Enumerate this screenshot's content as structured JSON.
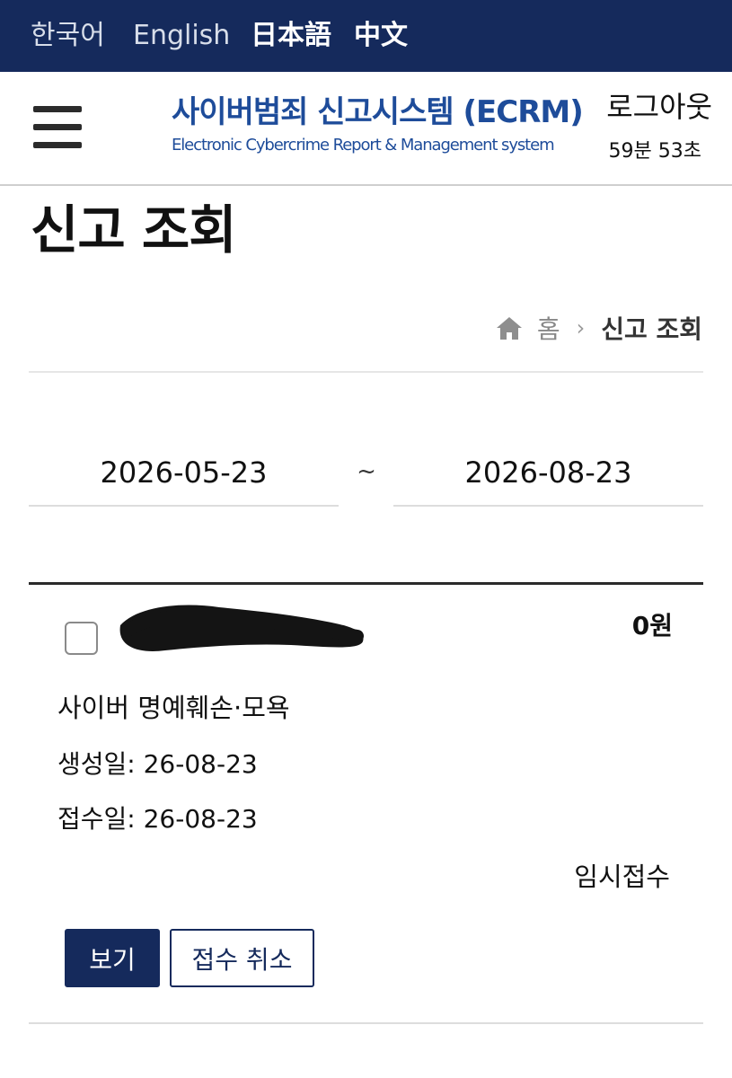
{
  "languages": [
    {
      "label": "한국어",
      "selected": false
    },
    {
      "label": "English",
      "selected": false
    },
    {
      "label": "日本語",
      "selected": true
    },
    {
      "label": "中文",
      "selected": true
    }
  ],
  "header": {
    "title": "사이버범죄 신고시스템 (ECRM)",
    "subtitle": "Electronic Cybercrime Report & Management system",
    "logout_label": "로그아웃",
    "session_timer": "59분 53초",
    "menu_icon": "hamburger-menu-icon"
  },
  "page": {
    "title": "신고 조회"
  },
  "breadcrumb": {
    "home_icon": "home-icon",
    "home_label": "홈",
    "separator": "›",
    "current": "신고 조회"
  },
  "date_range": {
    "from": "2026-05-23",
    "separator": "~",
    "to": "2026-08-23"
  },
  "report": {
    "checked": false,
    "amount": "0원",
    "crime_type": "사이버 명예훼손·모욕",
    "created": "생성일: 26-08-23",
    "received": "접수일: 26-08-23",
    "status": "임시접수",
    "view_button": "보기",
    "cancel_button": "접수 취소"
  },
  "colors": {
    "navy": "#152a5c",
    "brand_blue": "#1e4c9a"
  }
}
